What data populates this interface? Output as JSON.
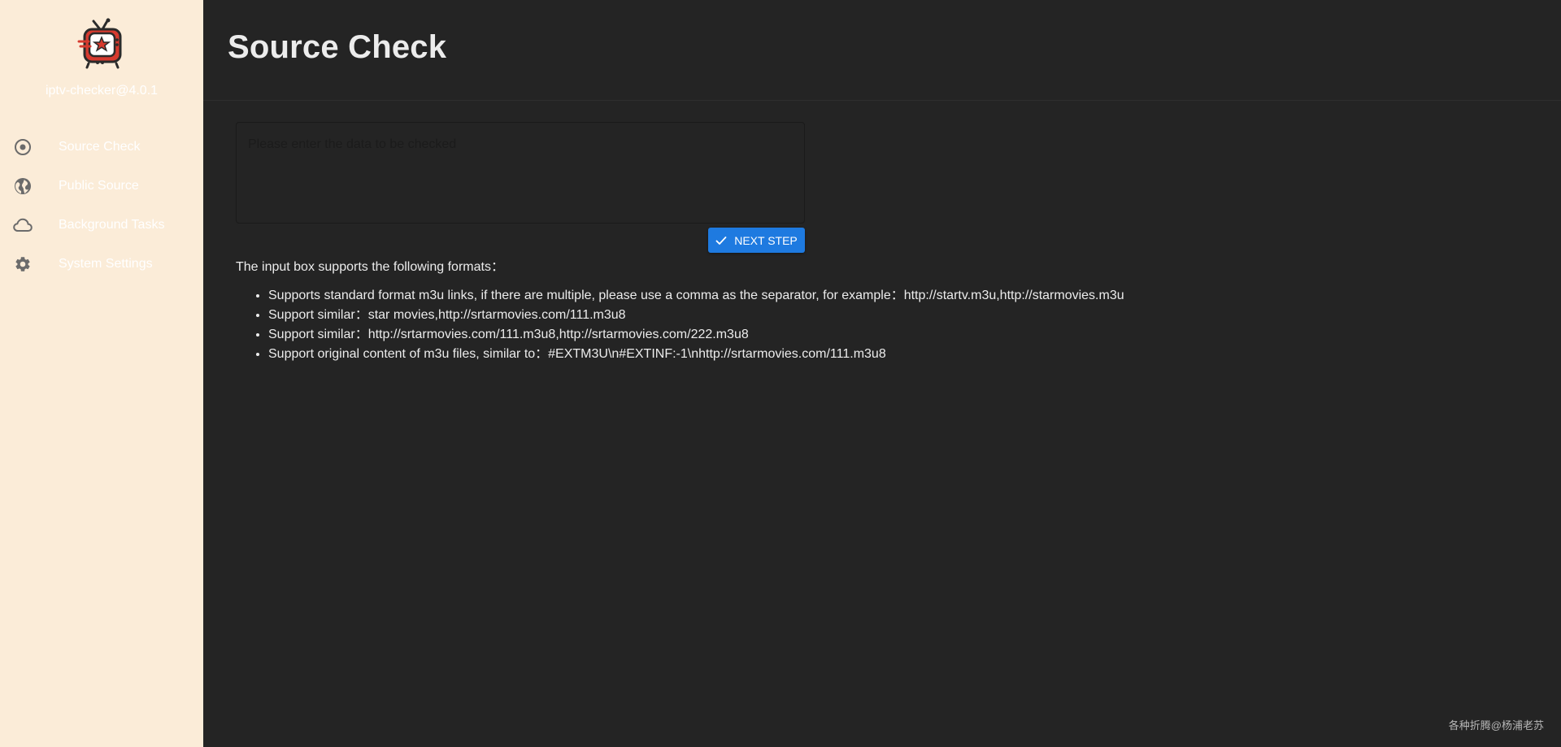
{
  "app": {
    "version_label": "iptv-checker@4.0.1",
    "logo_icon": "retro-tv-star-icon",
    "colors": {
      "sidebar_bg": "#fbecd8",
      "main_bg": "#242424",
      "accent": "#1e7ae0",
      "logo_red": "#d63a2f",
      "logo_dark": "#2b2b2b"
    }
  },
  "sidebar": {
    "items": [
      {
        "label": "Source Check",
        "icon": "radio-target-icon"
      },
      {
        "label": "Public Source",
        "icon": "globe-icon"
      },
      {
        "label": "Background Tasks",
        "icon": "cloud-icon"
      },
      {
        "label": "System Settings",
        "icon": "gear-icon"
      }
    ]
  },
  "header": {
    "title": "Source Check"
  },
  "main": {
    "input_placeholder": "Please enter the data to be checked",
    "input_value": "",
    "next_button_label": "NEXT STEP",
    "next_button_icon": "check-icon",
    "formats_heading": "The input box supports the following formats：",
    "formats": [
      "Supports standard format m3u links, if there are multiple, please use a comma as the separator, for example：http://startv.m3u,http://starmovies.m3u",
      "Support similar：star movies,http://srtarmovies.com/111.m3u8",
      "Support similar：http://srtarmovies.com/111.m3u8,http://srtarmovies.com/222.m3u8",
      "Support original content of m3u files, similar to：#EXTM3U\\n#EXTINF:-1\\nhttp://srtarmovies.com/111.m3u8"
    ]
  },
  "watermark": "各种折腾@杨浦老苏"
}
